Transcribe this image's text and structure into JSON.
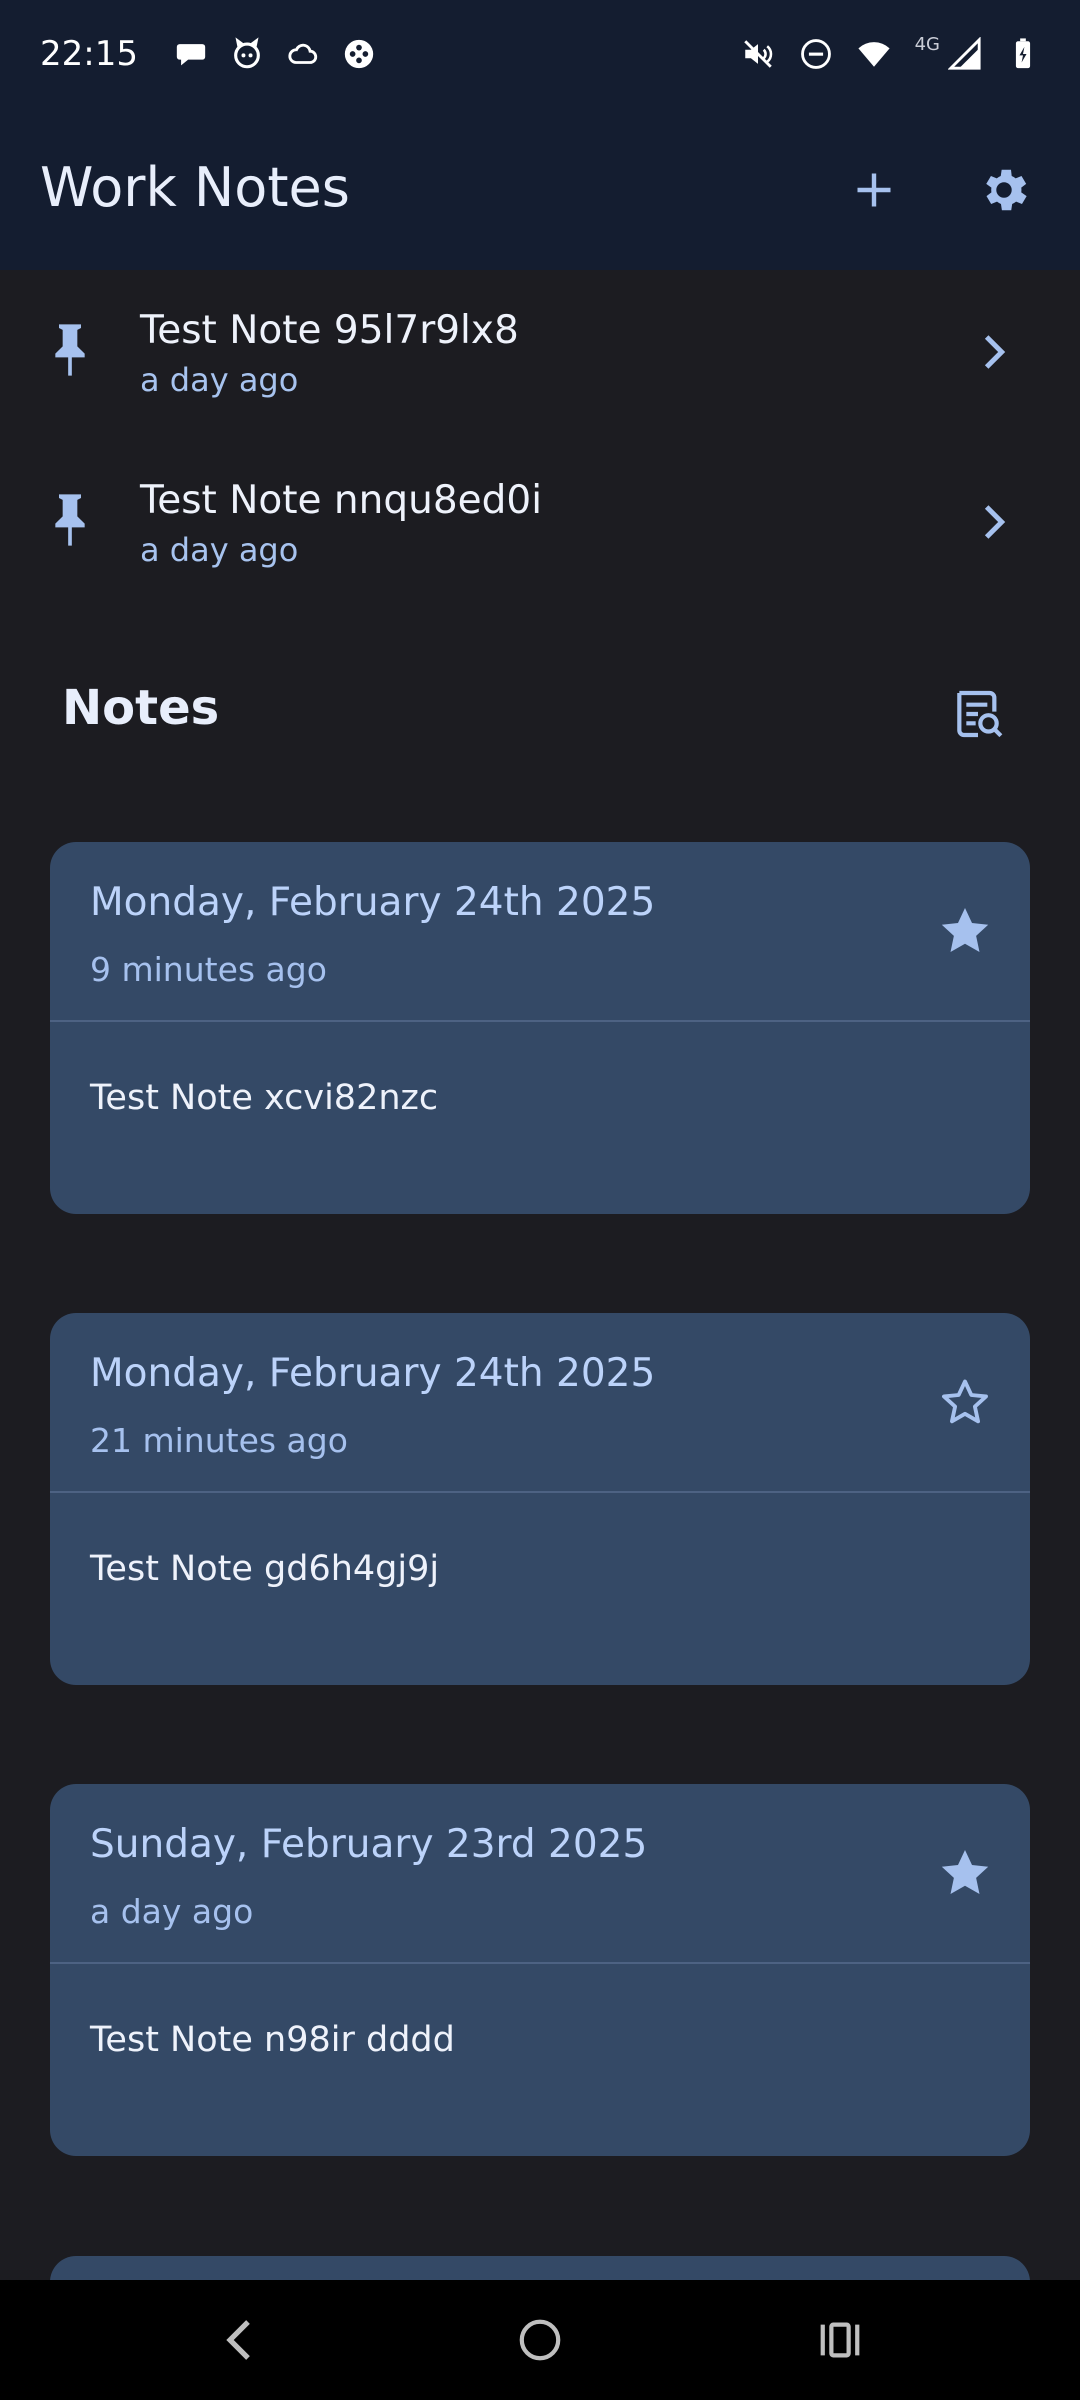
{
  "status_bar": {
    "time": "22:15",
    "network_label": "4G",
    "left_icons": [
      "chat-bubble-icon",
      "cat-face-icon",
      "cloud-icon",
      "game-controller-icon"
    ],
    "right_icons": [
      "muted-speaker-icon",
      "do-not-disturb-icon",
      "wifi-icon",
      "signal-icon",
      "battery-charging-icon"
    ]
  },
  "app_bar": {
    "title": "Work Notes",
    "actions": [
      "add-icon",
      "settings-gear-icon"
    ]
  },
  "pinned": [
    {
      "title": "Test Note 95l7r9lx8",
      "subtitle": "a day ago"
    },
    {
      "title": "Test Note nnqu8ed0i",
      "subtitle": "a day ago"
    }
  ],
  "notes_section": {
    "title": "Notes",
    "action": "search-notes-icon"
  },
  "notes": [
    {
      "date": "Monday, February 24th 2025",
      "ago": "9 minutes ago",
      "content": "Test Note xcvi82nzc",
      "starred": true
    },
    {
      "date": "Monday, February 24th 2025",
      "ago": "21 minutes ago",
      "content": "Test Note gd6h4gj9j",
      "starred": false
    },
    {
      "date": "Sunday, February 23rd 2025",
      "ago": "a day ago",
      "content": "Test Note n98ir dddd",
      "starred": true
    }
  ],
  "nav_bar": [
    "back-icon",
    "home-icon",
    "recents-icon"
  ],
  "colors": {
    "app_bar_bg": "#141d30",
    "page_bg": "#1c1c21",
    "card_bg": "#344966",
    "accent": "#a6c1ee"
  }
}
